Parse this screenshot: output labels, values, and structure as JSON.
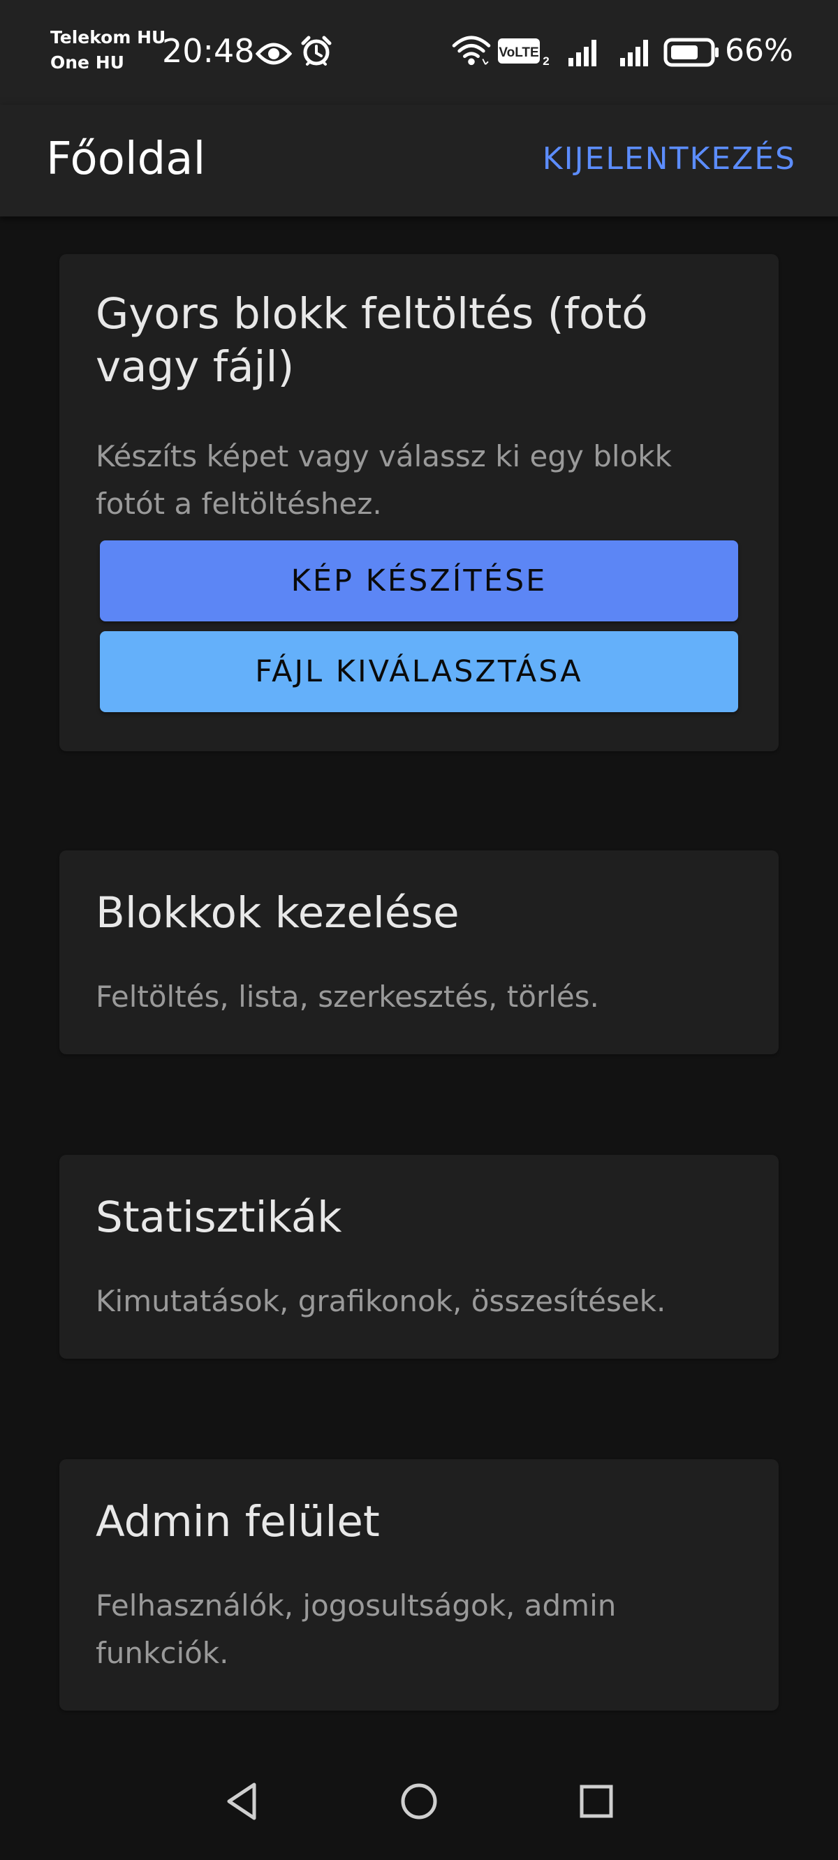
{
  "status_bar": {
    "carrier_line1": "Telekom HU",
    "carrier_line2": "One HU",
    "time": "20:48",
    "battery_percent": "66%",
    "volte_label": "VoLTE",
    "sim_index": "2",
    "icons": [
      "eye-icon",
      "alarm-icon",
      "wifi-icon",
      "volte-icon",
      "signal-icon",
      "signal-icon",
      "battery-icon"
    ]
  },
  "app_bar": {
    "title": "Főoldal",
    "logout_label": "KIJELENTKEZÉS"
  },
  "cards": {
    "quick_upload": {
      "title": "Gyors blokk feltöltés (fotó vagy fájl)",
      "description": "Készíts képet vagy válassz ki egy blokk fotót a feltöltéshez.",
      "take_photo_label": "KÉP KÉSZÍTÉSE",
      "choose_file_label": "FÁJL KIVÁLASZTÁSA"
    },
    "manage_blocks": {
      "title": "Blokkok kezelése",
      "description": "Feltöltés, lista, szerkesztés, törlés."
    },
    "statistics": {
      "title": "Statisztikák",
      "description": "Kimutatások, grafikonok, összesítések."
    },
    "admin": {
      "title": "Admin felület",
      "description": "Felhasználók, jogosultságok, admin funkciók."
    }
  },
  "colors": {
    "background": "#121212",
    "bar": "#222222",
    "card": "#1f1f1f",
    "accent": "#5c8dff",
    "primary_button": "#5c86f5",
    "secondary_button": "#64b0fa",
    "muted_text": "#9a9a9a"
  },
  "nav_bar": {
    "icons": [
      "back-icon",
      "home-icon",
      "recents-icon"
    ]
  }
}
